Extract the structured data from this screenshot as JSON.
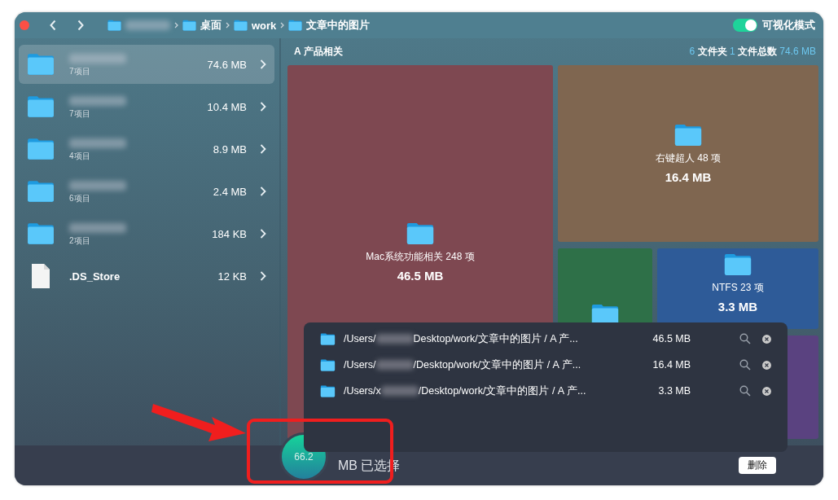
{
  "toolbar": {
    "breadcrumb": [
      {
        "kind": "hidden"
      },
      {
        "kind": "named",
        "label": "桌面"
      },
      {
        "kind": "named",
        "label": "work"
      },
      {
        "kind": "named",
        "label": "文章中的图片"
      }
    ],
    "visual_mode": {
      "label": "可视化模式",
      "on": true
    }
  },
  "sidebar": {
    "items": [
      {
        "kind": "folder",
        "count": "7项目",
        "size": "74.6 MB",
        "selected": true
      },
      {
        "kind": "folder",
        "count": "7项目",
        "size": "10.4 MB",
        "selected": false
      },
      {
        "kind": "folder",
        "count": "4项目",
        "size": "8.9 MB",
        "selected": false
      },
      {
        "kind": "folder",
        "count": "6项目",
        "size": "2.4 MB",
        "selected": false
      },
      {
        "kind": "folder",
        "count": "2项目",
        "size": "184 KB",
        "selected": false
      },
      {
        "kind": "file",
        "name": ".DS_Store",
        "size": "12 KB",
        "selected": false
      }
    ]
  },
  "content": {
    "title": "A 产品相关",
    "summary": {
      "folders": "6",
      "folders_label": "文件夹",
      "files": "1",
      "files_label": "文件总数",
      "total": "74.6 MB"
    },
    "tiles": [
      {
        "kind": "labeled",
        "label": "Mac系统功能相关 248 项",
        "size": "46.5 MB",
        "color": "#7e4851"
      },
      {
        "kind": "labeled",
        "label": "右键超人 48 项",
        "size": "16.4 MB",
        "color": "#7f6650"
      },
      {
        "kind": "icon",
        "color": "#2e7048"
      },
      {
        "kind": "labeled",
        "label": "NTFS 23 项",
        "size": "3.3 MB",
        "color": "#2e5b98"
      },
      {
        "kind": "plain",
        "color": "#5a4280"
      }
    ]
  },
  "selection_popup": {
    "rows": [
      {
        "path_start": "/Users/",
        "path_end": "Desktop/work/文章中的图片 / A 产...",
        "size": "46.5 MB"
      },
      {
        "path_start": "/Users/",
        "path_end": "/Desktop/work/文章中的图片 / A 产...",
        "size": "16.4 MB"
      },
      {
        "path_start": "/Users/x",
        "path_end": "/Desktop/work/文章中的图片 / A 产...",
        "size": "3.3 MB"
      }
    ]
  },
  "bottom_bar": {
    "selected_amount": "66.2",
    "selected_label": "MB 已选择",
    "delete_button": "删除"
  }
}
